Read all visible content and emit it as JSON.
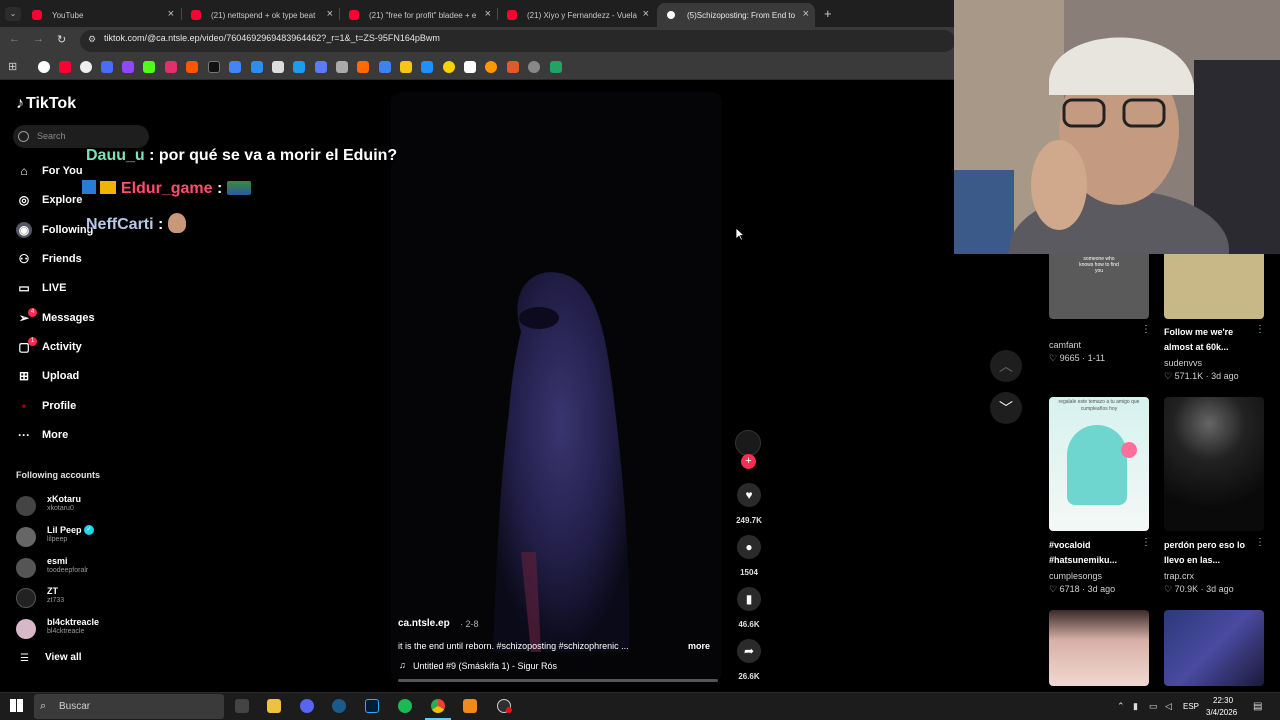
{
  "browser": {
    "tabs": [
      {
        "title": "YouTube",
        "icon": "youtube-icon"
      },
      {
        "title": "(21) nettspend + ok type beat",
        "icon": "youtube-icon"
      },
      {
        "title": "(21) \"free for profit\" bladee + e",
        "icon": "youtube-icon"
      },
      {
        "title": "(21) Xiyo y Fernandezz - Vuela",
        "icon": "youtube-icon"
      },
      {
        "title": "(5)Schizoposting: From End to",
        "icon": "tiktok-icon",
        "active": true
      }
    ],
    "new_tab": "+",
    "url": "tiktok.com/@ca.ntsle.ep/video/7604692969483964462?_r=1&_t=ZS-95FN164pBwm"
  },
  "sidebar": {
    "logo": "TikTok",
    "search_placeholder": "Search",
    "nav": [
      {
        "label": "For You",
        "icon": "home-icon"
      },
      {
        "label": "Explore",
        "icon": "compass-icon"
      },
      {
        "label": "Following",
        "icon": "following-icon"
      },
      {
        "label": "Friends",
        "icon": "friends-icon"
      },
      {
        "label": "LIVE",
        "icon": "live-icon"
      },
      {
        "label": "Messages",
        "icon": "messages-icon",
        "badge": "4"
      },
      {
        "label": "Activity",
        "icon": "activity-icon",
        "badge": "1"
      },
      {
        "label": "Upload",
        "icon": "upload-icon"
      },
      {
        "label": "Profile",
        "icon": "profile-icon"
      },
      {
        "label": "More",
        "icon": "more-icon"
      }
    ],
    "following_title": "Following accounts",
    "accounts": [
      {
        "name": "xKotaru",
        "handle": "xkotaru0"
      },
      {
        "name": "Lil Peep",
        "handle": "lilpeep",
        "verified": true
      },
      {
        "name": "esmi",
        "handle": "toodeepforalr"
      },
      {
        "name": "ZT",
        "handle": "zt733"
      },
      {
        "name": "bl4cktreacle",
        "handle": "bl4cktreacle"
      }
    ],
    "view_all": "View all"
  },
  "chat": [
    {
      "user": "Dauu_u",
      "sep": ":",
      "message": "por qué se va a morir el Eduin?",
      "user_color": "#7ee0b8"
    },
    {
      "user": "Eldur_game",
      "sep": ":",
      "message": "",
      "user_color": "#ff4d6d"
    },
    {
      "user": "NeffCarti",
      "sep": ":",
      "message": "",
      "user_color": "#b8c8e8"
    }
  ],
  "video": {
    "author": "ca.ntsle.ep",
    "date": "· 2-8",
    "description": "it is the end until reborn. #schizoposting #schizophrenic ...",
    "more": "more",
    "music": "Untitled #9 (Smáskífa 1) - Sigur Rós",
    "likes": "249.7K",
    "comments": "1504",
    "saves": "46.6K",
    "shares": "26.6K"
  },
  "grid": [
    {
      "title": "",
      "author": "camfant",
      "likes": "9665",
      "date": "1-11"
    },
    {
      "title": "Follow me we're almost at 60k...",
      "author": "sudenvvs",
      "likes": "571.1K",
      "date": "3d ago"
    },
    {
      "title": "#vocaloid #hatsunemiku...",
      "author": "cumplesongs",
      "likes": "6718",
      "date": "3d ago"
    },
    {
      "title": "perdón pero eso lo llevo en las...",
      "author": "trap.crx",
      "likes": "70.9K",
      "date": "3d ago"
    }
  ],
  "thumb_texts": {
    "t1": "someone who knows how to find you",
    "t3": "regalale este temazo a tu amigo que cumpleaños hoy"
  },
  "taskbar": {
    "search_placeholder": "Buscar",
    "lang": "ESP",
    "time": "22:30",
    "date": "3/4/2026"
  }
}
